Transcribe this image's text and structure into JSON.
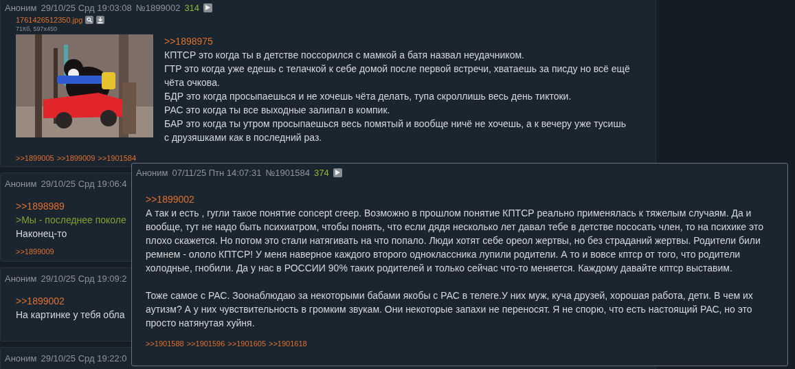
{
  "posts": [
    {
      "author": "Аноним",
      "date": "29/10/25 Срд 19:03:08",
      "number": "№1899002",
      "score": "314",
      "file": {
        "name": "1761426512350.jpg",
        "meta": "71Кб, 597x450",
        "kind": "picture"
      },
      "lines": [
        {
          "kind": "reply",
          "text": ">>1898975"
        },
        {
          "kind": "text",
          "text": "КПТСР это когда ты в детстве поссорился с мамкой а батя назвал неудачником."
        },
        {
          "kind": "text",
          "text": "ГТР это когда уже едешь с телачкой к себе домой после первой встречи, хватаешь за писду но всё ещё чёта очкова."
        },
        {
          "kind": "text",
          "text": "БДР это когда просыпаешься и не хочешь чёта делать, тупа скроллишь весь день тиктоки."
        },
        {
          "kind": "text",
          "text": "РАС это когда ты все выходные залипал в компик."
        },
        {
          "kind": "text",
          "text": "БАР это когда ты утром просыпаешься весь помятый и вообще ничё не хочешь, а к вечеру уже тусишь с друзяшками как в последний раз."
        }
      ],
      "replies": [
        ">>1899005",
        ">>1899009",
        ">>1901584"
      ]
    },
    {
      "author": "Аноним",
      "date": "29/10/25 Срд 19:06:4",
      "lines": [
        {
          "kind": "reply",
          "text": ">>1898989"
        },
        {
          "kind": "quote",
          "text": ">Мы - последнее поколе"
        },
        {
          "kind": "text",
          "text": "Наконец-то"
        }
      ],
      "replies": [
        ">>1899009"
      ]
    },
    {
      "author": "Аноним",
      "date": "29/10/25 Срд 19:09:2",
      "lines": [
        {
          "kind": "reply",
          "text": ">>1899002"
        },
        {
          "kind": "text",
          "text": "На картинке у тебя обла"
        }
      ]
    },
    {
      "author": "Аноним",
      "date": "29/10/25 Срд 19:22:0"
    }
  ],
  "popup": {
    "author": "Аноним",
    "date": "07/11/25 Птн 14:07:31",
    "number": "№1901584",
    "score": "374",
    "lines": [
      {
        "kind": "reply",
        "text": ">>1899002"
      },
      {
        "kind": "text",
        "text": "А так и есть , гугли такое понятие concept creep. Возможно в прошлом понятие КПТСР реально применялась к тяжелым случаям. Да и вообще, тут не надо быть психиатром, чтобы понять, что если дядя несколько лет давал тебе в детстве пососать член, то на психике это плохо скажется. Но потом это стали натягивать на что попало. Люди хотят себе ореол жертвы, но без страданий жертвы. Родители били ремнем - ололо КПТСР! У меня наверное каждого второго одноклассника лупили родители. А то и вовсе кптср от того, что родители холодные, гнобили. Да у нас в РОССИИ 90% таких родителей и только сейчас что-то меняется. Каждому давайте кптср выставим."
      },
      {
        "kind": "gap"
      },
      {
        "kind": "text",
        "text": "Тоже самое с РАС. Зоонаблюдаю за некоторыми бабами якобы с РАС в телеге.У них муж, куча друзей, хорошая работа, дети. В чем их аутизм? А у них чувствительность в громким звукам. Они некоторые запахи не переносят. Я не спорю, что есть настоящий РАС, но это просто натянутая хуйня."
      }
    ],
    "replies": [
      ">>1901588",
      ">>1901596",
      ">>1901605",
      ">>1901618"
    ]
  }
}
